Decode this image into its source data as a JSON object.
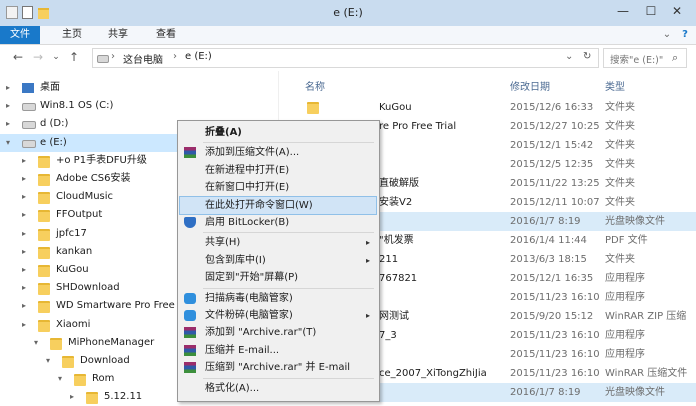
{
  "window": {
    "title": "e (E:)",
    "minimize": "—",
    "maximize": "☐",
    "close": "✕"
  },
  "ribbon": {
    "tabs": [
      "文件",
      "主页",
      "共享",
      "查看"
    ],
    "expand": "⌄",
    "help": "?"
  },
  "nav": {
    "back": "←",
    "forward": "→",
    "recent": "⌄",
    "up": "↑",
    "breadcrumb": [
      "这台电脑",
      "e (E:)"
    ],
    "sep": "›",
    "dropdown": "⌄",
    "refresh": "↻",
    "search_placeholder": "搜索\"e (E:)\"",
    "search_icon": "⌕"
  },
  "tree": [
    {
      "label": "桌面",
      "level": 1,
      "icon": "desktop"
    },
    {
      "label": "Win8.1 OS (C:)",
      "level": 1,
      "icon": "drive"
    },
    {
      "label": "d (D:)",
      "level": 1,
      "icon": "drive"
    },
    {
      "label": "e (E:)",
      "level": 1,
      "icon": "drive",
      "selected": true
    },
    {
      "label": "+o P1手表DFU升级",
      "level": 2,
      "icon": "folder"
    },
    {
      "label": "Adobe CS6安装",
      "level": 2,
      "icon": "folder"
    },
    {
      "label": "CloudMusic",
      "level": 2,
      "icon": "folder"
    },
    {
      "label": "FFOutput",
      "level": 2,
      "icon": "folder"
    },
    {
      "label": "jpfc17",
      "level": 2,
      "icon": "folder"
    },
    {
      "label": "kankan",
      "level": 2,
      "icon": "folder"
    },
    {
      "label": "KuGou",
      "level": 2,
      "icon": "folder"
    },
    {
      "label": "SHDownload",
      "level": 2,
      "icon": "folder"
    },
    {
      "label": "WD Smartware Pro Free T",
      "level": 2,
      "icon": "folder"
    },
    {
      "label": "Xiaomi",
      "level": 2,
      "icon": "folder"
    },
    {
      "label": "MiPhoneManager",
      "level": 3,
      "icon": "folder"
    },
    {
      "label": "Download",
      "level": 4,
      "icon": "folder"
    },
    {
      "label": "Rom",
      "level": 5,
      "icon": "folder"
    },
    {
      "label": "5.12.11",
      "level": 6,
      "icon": "folder"
    }
  ],
  "list": {
    "headers": {
      "name": "名称",
      "date": "修改日期",
      "type": "类型"
    },
    "rows": [
      {
        "name": "KuGou",
        "date": "2015/12/6 16:33",
        "type": "文件夹"
      },
      {
        "name": "re Pro Free Trial",
        "date": "2015/12/27 10:25",
        "type": "文件夹"
      },
      {
        "name": "",
        "date": "2015/12/1 15:42",
        "type": "文件夹"
      },
      {
        "name": "",
        "date": "2015/12/5 12:35",
        "type": "文件夹"
      },
      {
        "name": "直破解版",
        "date": "2015/11/22 13:25",
        "type": "文件夹"
      },
      {
        "name": "安装V2",
        "date": "2015/12/11 10:07",
        "type": "文件夹"
      },
      {
        "name": "",
        "date": "2016/1/7 8:19",
        "type": "光盘映像文件"
      },
      {
        "name": "\"机发票",
        "date": "2016/1/4 11:44",
        "type": "PDF 文件"
      },
      {
        "name": "211",
        "date": "2013/6/3 18:15",
        "type": "文件夹"
      },
      {
        "name": "767821",
        "date": "2015/12/1 16:35",
        "type": "应用程序"
      },
      {
        "name": "",
        "date": "2015/11/23 16:10",
        "type": "应用程序"
      },
      {
        "name": "网测试",
        "date": "2015/9/20 15:12",
        "type": "WinRAR ZIP 压缩"
      },
      {
        "name": "7_3",
        "date": "2015/11/23 16:10",
        "type": "应用程序"
      },
      {
        "name": "",
        "date": "2015/11/23 16:10",
        "type": "应用程序"
      },
      {
        "name": "ce_2007_XiTongZhiJia",
        "date": "2015/11/23 16:10",
        "type": "WinRAR 压缩文件"
      },
      {
        "name": "",
        "date": "2016/1/7 8:19",
        "type": "光盘映像文件"
      }
    ]
  },
  "context_menu": {
    "items": [
      {
        "label": "折叠(A)",
        "bold": true,
        "icon": ""
      },
      {
        "sep": true
      },
      {
        "label": "添加到压缩文件(A)...",
        "icon": "rar"
      },
      {
        "label": "在新进程中打开(E)",
        "icon": ""
      },
      {
        "label": "在新窗口中打开(E)",
        "icon": ""
      },
      {
        "label": "在此处打开命令窗口(W)",
        "icon": "",
        "hover": true
      },
      {
        "label": "启用 BitLocker(B)",
        "icon": "shield"
      },
      {
        "sep": true
      },
      {
        "label": "共享(H)",
        "icon": "",
        "submenu": true
      },
      {
        "label": "包含到库中(I)",
        "icon": "",
        "submenu": true
      },
      {
        "label": "固定到\"开始\"屏幕(P)",
        "icon": ""
      },
      {
        "sep": true
      },
      {
        "label": "扫描病毒(电脑管家)",
        "icon": "guard"
      },
      {
        "label": "文件粉碎(电脑管家)",
        "icon": "guard",
        "submenu": true
      },
      {
        "label": "添加到 \"Archive.rar\"(T)",
        "icon": "rar"
      },
      {
        "label": "压缩并 E-mail...",
        "icon": "rar"
      },
      {
        "label": "压缩到 \"Archive.rar\" 并 E-mail",
        "icon": "rar"
      },
      {
        "sep": true
      },
      {
        "label": "格式化(A)...",
        "icon": ""
      }
    ],
    "submenu_glyph": "▸"
  }
}
